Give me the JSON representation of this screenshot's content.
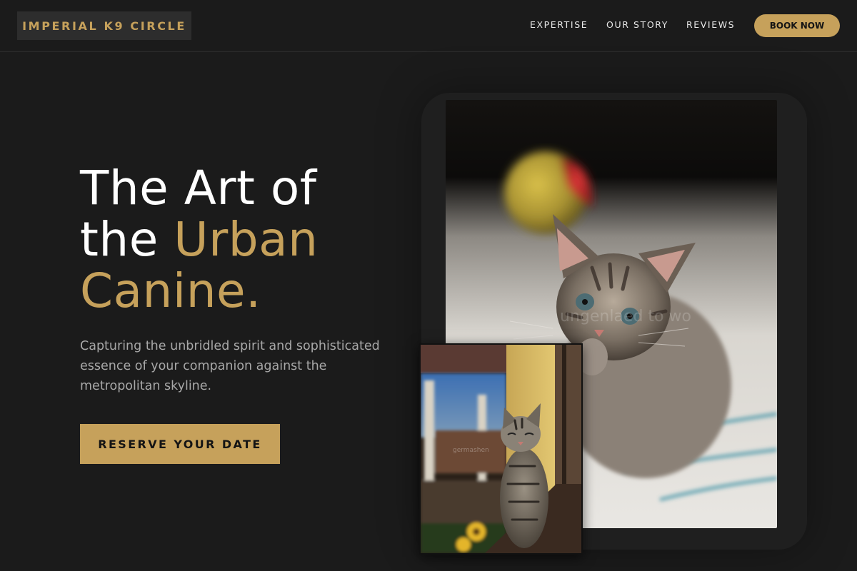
{
  "nav": {
    "logo": "IMPERIAL K9 CIRCLE",
    "links": [
      "EXPERTISE",
      "OUR STORY",
      "REVIEWS"
    ],
    "book_label": "BOOK NOW"
  },
  "hero": {
    "headline_line1": "The Art of",
    "headline_line2_plain": "the ",
    "headline_line2_accent": "Urban",
    "headline_line3_accent": "Canine.",
    "subtext": "Capturing the unbridled spirit and sophisticated essence of your companion against the metropolitan skyline.",
    "cta_label": "RESERVE YOUR DATE"
  },
  "images": {
    "main": "kitten-with-ball-photo",
    "secondary": "tabby-cat-on-railing-photo"
  },
  "colors": {
    "background": "#1b1b1b",
    "accent": "#c6a15b",
    "text": "#ffffff",
    "muted_text": "#a8a8a8"
  }
}
